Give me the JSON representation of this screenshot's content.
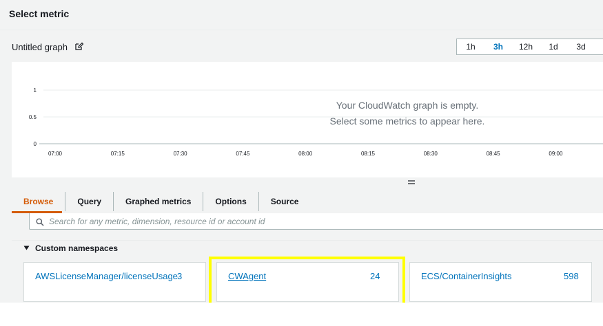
{
  "header": {
    "title": "Select metric"
  },
  "graph": {
    "title": "Untitled graph",
    "empty_line1": "Your CloudWatch graph is empty.",
    "empty_line2": "Select some metrics to appear here.",
    "y_ticks": [
      "1",
      "0.5",
      "0"
    ],
    "x_ticks": [
      "07:00",
      "07:15",
      "07:30",
      "07:45",
      "08:00",
      "08:15",
      "08:30",
      "08:45",
      "09:00"
    ]
  },
  "time_range": {
    "options": [
      "1h",
      "3h",
      "12h",
      "1d",
      "3d"
    ],
    "selected": "3h"
  },
  "tabs": [
    "Browse",
    "Query",
    "Graphed metrics",
    "Options",
    "Source"
  ],
  "active_tab": "Browse",
  "search": {
    "placeholder": "Search for any metric, dimension, resource id or account id",
    "value": ""
  },
  "namespaces": {
    "section_title": "Custom namespaces",
    "items": [
      {
        "name": "AWSLicenseManager/licenseUsage",
        "count": "3"
      },
      {
        "name": "CWAgent",
        "count": "24"
      },
      {
        "name": "ECS/ContainerInsights",
        "count": "598"
      }
    ]
  },
  "colors": {
    "link": "#0073bb",
    "active_tab": "#d45b07",
    "highlight": "#ffff00"
  },
  "icons": [
    "edit-icon",
    "search-icon",
    "caret-down-icon",
    "drag-handle-icon"
  ]
}
